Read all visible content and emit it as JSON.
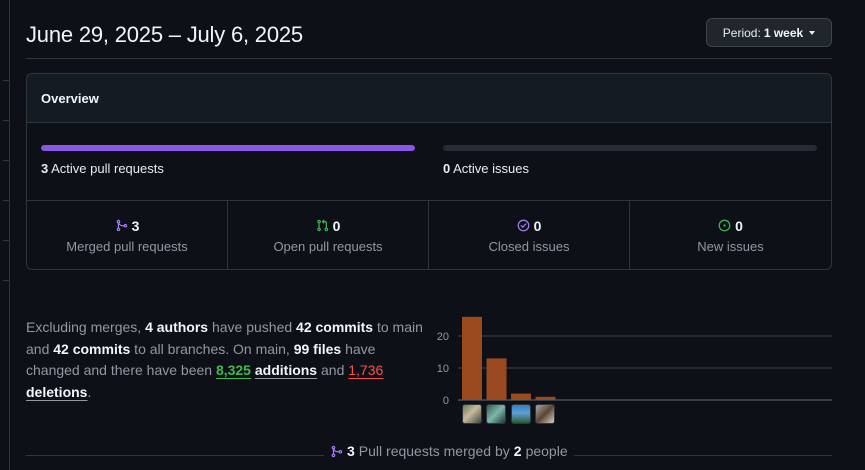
{
  "header": {
    "title": "June 29, 2025 – July 6, 2025",
    "period_prefix": "Period:",
    "period_value": "1 week"
  },
  "overview": {
    "heading": "Overview",
    "pull_requests": {
      "count": "3",
      "label": "Active pull requests",
      "fill_fraction": 1.0,
      "color": "#8957e5"
    },
    "issues": {
      "count": "0",
      "label": "Active issues",
      "fill_fraction": 0.0
    },
    "stats": [
      {
        "icon": "merge-icon",
        "color": "#ab7df8",
        "count": "3",
        "label": "Merged pull requests"
      },
      {
        "icon": "pull-request-icon",
        "color": "#3fb950",
        "count": "0",
        "label": "Open pull requests"
      },
      {
        "icon": "issue-closed-icon",
        "color": "#ab7df8",
        "count": "0",
        "label": "Closed issues"
      },
      {
        "icon": "issue-opened-icon",
        "color": "#3fb950",
        "count": "0",
        "label": "New issues"
      }
    ]
  },
  "summary": {
    "t1": "Excluding merges, ",
    "authors": "4 authors",
    "t2": " have pushed ",
    "commits_main": "42 commits",
    "t3": " to main and ",
    "commits_all": "42 commits",
    "t4": " to all branches. On main, ",
    "files": "99 files",
    "t5": " have changed and there have been ",
    "additions_num": "8,325",
    "additions_word": "additions",
    "t6": " and ",
    "deletions_num": "1,736",
    "deletions_word": "deletions",
    "t7": "."
  },
  "chart_data": {
    "type": "bar",
    "categories": [
      "author-1",
      "author-2",
      "author-3",
      "author-4"
    ],
    "values": [
      26,
      13,
      2,
      1
    ],
    "yticks": [
      "20",
      "10",
      "0"
    ],
    "ytick_values": [
      20,
      10,
      0
    ],
    "bar_color": "#9b4a1f",
    "grid": true
  },
  "merged": {
    "count": "3",
    "text1": "Pull requests merged by",
    "people": "2",
    "text2": "people"
  }
}
